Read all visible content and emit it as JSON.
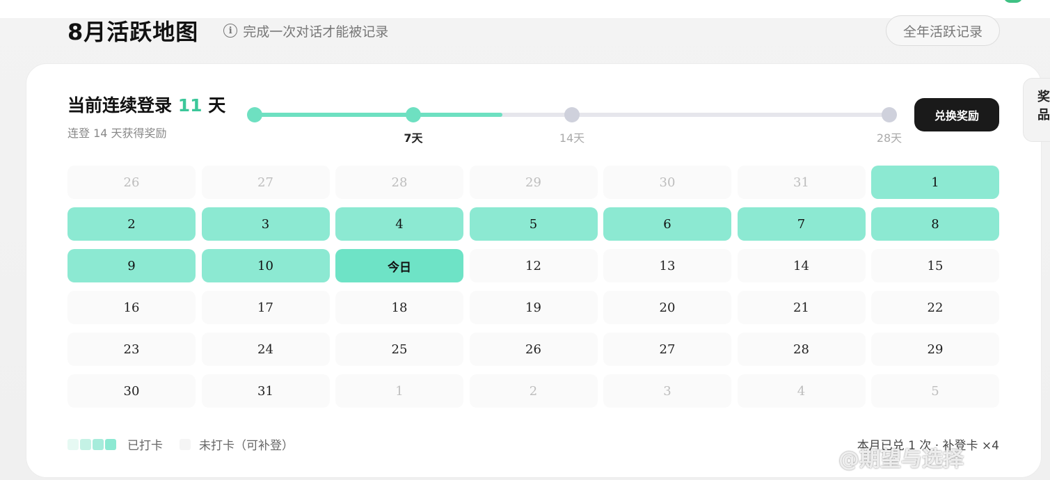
{
  "header": {
    "title": "8月活跃地图",
    "hint": "完成一次对话才能被记录",
    "year_button": "全年活跃记录"
  },
  "side_tab": {
    "line1": "奖",
    "line2": "品"
  },
  "streak": {
    "prefix": "当前连续登录",
    "days": "11",
    "suffix": "天",
    "subtitle": "连登 14 天获得奖励",
    "progress_fraction": 0.39,
    "milestones": [
      "7天",
      "14天",
      "28天"
    ],
    "redeem_button": "兑换奖励"
  },
  "calendar": {
    "cells": [
      {
        "label": "26",
        "state": "outside"
      },
      {
        "label": "27",
        "state": "outside"
      },
      {
        "label": "28",
        "state": "outside"
      },
      {
        "label": "29",
        "state": "outside"
      },
      {
        "label": "30",
        "state": "outside"
      },
      {
        "label": "31",
        "state": "outside"
      },
      {
        "label": "1",
        "state": "checked"
      },
      {
        "label": "2",
        "state": "checked"
      },
      {
        "label": "3",
        "state": "checked"
      },
      {
        "label": "4",
        "state": "checked"
      },
      {
        "label": "5",
        "state": "checked"
      },
      {
        "label": "6",
        "state": "checked"
      },
      {
        "label": "7",
        "state": "checked"
      },
      {
        "label": "8",
        "state": "checked"
      },
      {
        "label": "9",
        "state": "checked"
      },
      {
        "label": "10",
        "state": "checked"
      },
      {
        "label": "今日",
        "state": "today"
      },
      {
        "label": "12",
        "state": "normal"
      },
      {
        "label": "13",
        "state": "normal"
      },
      {
        "label": "14",
        "state": "normal"
      },
      {
        "label": "15",
        "state": "normal"
      },
      {
        "label": "16",
        "state": "normal"
      },
      {
        "label": "17",
        "state": "normal"
      },
      {
        "label": "18",
        "state": "normal"
      },
      {
        "label": "19",
        "state": "normal"
      },
      {
        "label": "20",
        "state": "normal"
      },
      {
        "label": "21",
        "state": "normal"
      },
      {
        "label": "22",
        "state": "normal"
      },
      {
        "label": "23",
        "state": "normal"
      },
      {
        "label": "24",
        "state": "normal"
      },
      {
        "label": "25",
        "state": "normal"
      },
      {
        "label": "26",
        "state": "normal"
      },
      {
        "label": "27",
        "state": "normal"
      },
      {
        "label": "28",
        "state": "normal"
      },
      {
        "label": "29",
        "state": "normal"
      },
      {
        "label": "30",
        "state": "normal"
      },
      {
        "label": "31",
        "state": "normal"
      },
      {
        "label": "1",
        "state": "outside"
      },
      {
        "label": "2",
        "state": "outside"
      },
      {
        "label": "3",
        "state": "outside"
      },
      {
        "label": "4",
        "state": "outside"
      },
      {
        "label": "5",
        "state": "outside"
      }
    ]
  },
  "legend": {
    "checked_label": "已打卡",
    "unchecked_label": "未打卡（可补登）",
    "swatch_colors": [
      "#e6f9f3",
      "#c4f2e5",
      "#a6ecdb",
      "#8ce9d2"
    ],
    "unchecked_color": "#f5f5f5"
  },
  "footer": {
    "summary": "本月已兑 1 次 · 补登卡 ×4"
  },
  "watermark": "@期望与选择"
}
